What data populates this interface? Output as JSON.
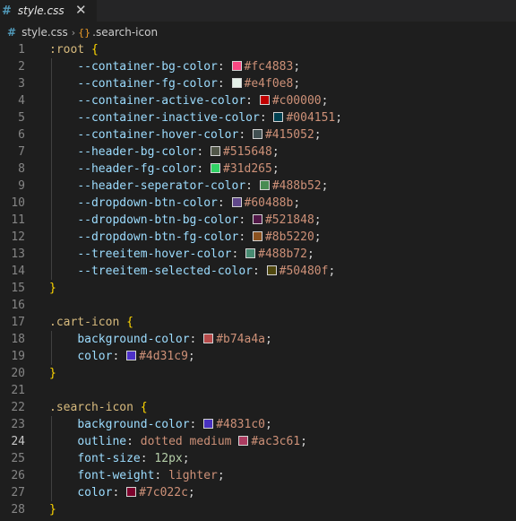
{
  "tab": {
    "icon": "#",
    "title": "style.css",
    "close_icon": "✕"
  },
  "breadcrumb": {
    "file_icon": "#",
    "file": "style.css",
    "separator": "›",
    "symbol_icon": "{}",
    "symbol": ".search-icon"
  },
  "active_line": 24,
  "lines": [
    {
      "n": "1",
      "tokens": [
        {
          "t": "sel",
          "v": ":root"
        },
        {
          "t": "txt",
          "v": " "
        },
        {
          "t": "brace",
          "v": "{"
        }
      ]
    },
    {
      "n": "2",
      "indent": true,
      "tokens": [
        {
          "t": "prop",
          "v": "--container-bg-color"
        },
        {
          "t": "punc",
          "v": ": "
        },
        {
          "t": "sw",
          "v": "#fc4883"
        },
        {
          "t": "val",
          "v": "#fc4883"
        },
        {
          "t": "punc",
          "v": ";"
        }
      ]
    },
    {
      "n": "3",
      "indent": true,
      "tokens": [
        {
          "t": "prop",
          "v": "--container-fg-color"
        },
        {
          "t": "punc",
          "v": ": "
        },
        {
          "t": "sw",
          "v": "#e4f0e8"
        },
        {
          "t": "val",
          "v": "#e4f0e8"
        },
        {
          "t": "punc",
          "v": ";"
        }
      ]
    },
    {
      "n": "4",
      "indent": true,
      "tokens": [
        {
          "t": "prop",
          "v": "--container-active-color"
        },
        {
          "t": "punc",
          "v": ": "
        },
        {
          "t": "sw",
          "v": "#c00000"
        },
        {
          "t": "val",
          "v": "#c00000"
        },
        {
          "t": "punc",
          "v": ";"
        }
      ]
    },
    {
      "n": "5",
      "indent": true,
      "tokens": [
        {
          "t": "prop",
          "v": "--container-inactive-color"
        },
        {
          "t": "punc",
          "v": ": "
        },
        {
          "t": "sw",
          "v": "#004151"
        },
        {
          "t": "val",
          "v": "#004151"
        },
        {
          "t": "punc",
          "v": ";"
        }
      ]
    },
    {
      "n": "6",
      "indent": true,
      "tokens": [
        {
          "t": "prop",
          "v": "--container-hover-color"
        },
        {
          "t": "punc",
          "v": ": "
        },
        {
          "t": "sw",
          "v": "#415052"
        },
        {
          "t": "val",
          "v": "#415052"
        },
        {
          "t": "punc",
          "v": ";"
        }
      ]
    },
    {
      "n": "7",
      "indent": true,
      "tokens": [
        {
          "t": "prop",
          "v": "--header-bg-color"
        },
        {
          "t": "punc",
          "v": ": "
        },
        {
          "t": "sw",
          "v": "#515648"
        },
        {
          "t": "val",
          "v": "#515648"
        },
        {
          "t": "punc",
          "v": ";"
        }
      ]
    },
    {
      "n": "8",
      "indent": true,
      "tokens": [
        {
          "t": "prop",
          "v": "--header-fg-color"
        },
        {
          "t": "punc",
          "v": ": "
        },
        {
          "t": "sw",
          "v": "#31d265"
        },
        {
          "t": "val",
          "v": "#31d265"
        },
        {
          "t": "punc",
          "v": ";"
        }
      ]
    },
    {
      "n": "9",
      "indent": true,
      "tokens": [
        {
          "t": "prop",
          "v": "--header-seperator-color"
        },
        {
          "t": "punc",
          "v": ": "
        },
        {
          "t": "sw",
          "v": "#488b52"
        },
        {
          "t": "val",
          "v": "#488b52"
        },
        {
          "t": "punc",
          "v": ";"
        }
      ]
    },
    {
      "n": "10",
      "indent": true,
      "tokens": [
        {
          "t": "prop",
          "v": "--dropdown-btn-color"
        },
        {
          "t": "punc",
          "v": ": "
        },
        {
          "t": "sw",
          "v": "#60488b"
        },
        {
          "t": "val",
          "v": "#60488b"
        },
        {
          "t": "punc",
          "v": ";"
        }
      ]
    },
    {
      "n": "11",
      "indent": true,
      "tokens": [
        {
          "t": "prop",
          "v": "--dropdown-btn-bg-color"
        },
        {
          "t": "punc",
          "v": ": "
        },
        {
          "t": "sw",
          "v": "#521848"
        },
        {
          "t": "val",
          "v": "#521848"
        },
        {
          "t": "punc",
          "v": ";"
        }
      ]
    },
    {
      "n": "12",
      "indent": true,
      "tokens": [
        {
          "t": "prop",
          "v": "--dropdown-btn-fg-color"
        },
        {
          "t": "punc",
          "v": ": "
        },
        {
          "t": "sw",
          "v": "#8b5220"
        },
        {
          "t": "val",
          "v": "#8b5220"
        },
        {
          "t": "punc",
          "v": ";"
        }
      ]
    },
    {
      "n": "13",
      "indent": true,
      "tokens": [
        {
          "t": "prop",
          "v": "--treeitem-hover-color"
        },
        {
          "t": "punc",
          "v": ": "
        },
        {
          "t": "sw",
          "v": "#488b72"
        },
        {
          "t": "val",
          "v": "#488b72"
        },
        {
          "t": "punc",
          "v": ";"
        }
      ]
    },
    {
      "n": "14",
      "indent": true,
      "tokens": [
        {
          "t": "prop",
          "v": "--treeitem-selected-color"
        },
        {
          "t": "punc",
          "v": ": "
        },
        {
          "t": "sw",
          "v": "#50480f"
        },
        {
          "t": "val",
          "v": "#50480f"
        },
        {
          "t": "punc",
          "v": ";"
        }
      ]
    },
    {
      "n": "15",
      "tokens": [
        {
          "t": "brace",
          "v": "}"
        }
      ]
    },
    {
      "n": "16",
      "tokens": []
    },
    {
      "n": "17",
      "tokens": [
        {
          "t": "sel",
          "v": ".cart-icon"
        },
        {
          "t": "txt",
          "v": " "
        },
        {
          "t": "brace",
          "v": "{"
        }
      ]
    },
    {
      "n": "18",
      "indent": true,
      "tokens": [
        {
          "t": "prop",
          "v": "background-color"
        },
        {
          "t": "punc",
          "v": ": "
        },
        {
          "t": "sw",
          "v": "#b74a4a"
        },
        {
          "t": "val",
          "v": "#b74a4a"
        },
        {
          "t": "punc",
          "v": ";"
        }
      ]
    },
    {
      "n": "19",
      "indent": true,
      "tokens": [
        {
          "t": "prop",
          "v": "color"
        },
        {
          "t": "punc",
          "v": ": "
        },
        {
          "t": "sw",
          "v": "#4d31c9"
        },
        {
          "t": "val",
          "v": "#4d31c9"
        },
        {
          "t": "punc",
          "v": ";"
        }
      ]
    },
    {
      "n": "20",
      "tokens": [
        {
          "t": "brace",
          "v": "}"
        }
      ]
    },
    {
      "n": "21",
      "tokens": []
    },
    {
      "n": "22",
      "tokens": [
        {
          "t": "sel",
          "v": ".search-icon"
        },
        {
          "t": "txt",
          "v": " "
        },
        {
          "t": "brace",
          "v": "{"
        }
      ]
    },
    {
      "n": "23",
      "indent": true,
      "tokens": [
        {
          "t": "prop",
          "v": "background-color"
        },
        {
          "t": "punc",
          "v": ": "
        },
        {
          "t": "sw",
          "v": "#4831c0"
        },
        {
          "t": "val",
          "v": "#4831c0"
        },
        {
          "t": "punc",
          "v": ";"
        }
      ]
    },
    {
      "n": "24",
      "indent": true,
      "tokens": [
        {
          "t": "prop",
          "v": "outline"
        },
        {
          "t": "punc",
          "v": ": "
        },
        {
          "t": "val",
          "v": "dotted medium "
        },
        {
          "t": "sw",
          "v": "#ac3c61"
        },
        {
          "t": "val",
          "v": "#ac3c61"
        },
        {
          "t": "punc",
          "v": ";"
        }
      ]
    },
    {
      "n": "25",
      "indent": true,
      "tokens": [
        {
          "t": "prop",
          "v": "font-size"
        },
        {
          "t": "punc",
          "v": ": "
        },
        {
          "t": "num",
          "v": "12px"
        },
        {
          "t": "punc",
          "v": ";"
        }
      ]
    },
    {
      "n": "26",
      "indent": true,
      "tokens": [
        {
          "t": "prop",
          "v": "font-weight"
        },
        {
          "t": "punc",
          "v": ": "
        },
        {
          "t": "val",
          "v": "lighter"
        },
        {
          "t": "punc",
          "v": ";"
        }
      ]
    },
    {
      "n": "27",
      "indent": true,
      "tokens": [
        {
          "t": "prop",
          "v": "color"
        },
        {
          "t": "punc",
          "v": ": "
        },
        {
          "t": "sw",
          "v": "#7c022c"
        },
        {
          "t": "val",
          "v": "#7c022c"
        },
        {
          "t": "punc",
          "v": ";"
        }
      ]
    },
    {
      "n": "28",
      "tokens": [
        {
          "t": "brace",
          "v": "}"
        }
      ]
    }
  ]
}
